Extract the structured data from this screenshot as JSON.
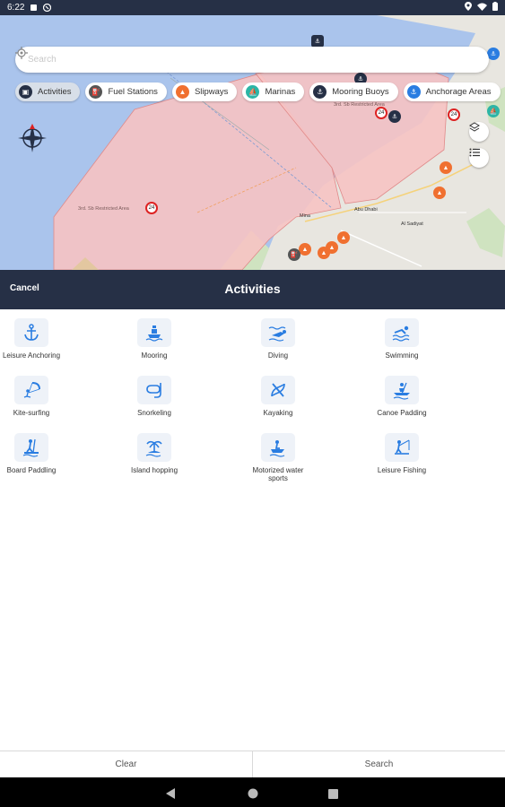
{
  "status_bar": {
    "time": "6:22"
  },
  "search": {
    "placeholder": "Search"
  },
  "chips": [
    {
      "label": "Activities",
      "color": "#263046",
      "icon": "activities-icon",
      "active": true
    },
    {
      "label": "Fuel Stations",
      "color": "#555555",
      "icon": "fuel-icon",
      "active": false
    },
    {
      "label": "Slipways",
      "color": "#f07030",
      "icon": "slipway-icon",
      "active": false
    },
    {
      "label": "Marinas",
      "color": "#2db5a6",
      "icon": "marina-icon",
      "active": false
    },
    {
      "label": "Mooring Buoys",
      "color": "#263046",
      "icon": "buoy-icon",
      "active": false
    },
    {
      "label": "Anchorage Areas",
      "color": "#2a7de1",
      "icon": "anchor-icon",
      "active": false
    }
  ],
  "map_labels": {
    "restricted_1": "3rd. Sb Restricted Area",
    "restricted_2": "3rd. Sb Restricted Area",
    "city": "Abu Dhabi",
    "district": "Al Sadiyat",
    "mina": "Mina"
  },
  "sheet": {
    "cancel_label": "Cancel",
    "title": "Activities"
  },
  "activities": [
    {
      "label": "Leisure Anchoring",
      "icon": "anchor-icon"
    },
    {
      "label": "Mooring",
      "icon": "mooring-icon"
    },
    {
      "label": "Diving",
      "icon": "diving-icon"
    },
    {
      "label": "Swimming",
      "icon": "swimming-icon"
    },
    {
      "label": "Kite-surfing",
      "icon": "kitesurfing-icon"
    },
    {
      "label": "Snorkeling",
      "icon": "snorkeling-icon"
    },
    {
      "label": "Kayaking",
      "icon": "kayaking-icon"
    },
    {
      "label": "Canoe Padding",
      "icon": "canoe-icon"
    },
    {
      "label": "Board Paddling",
      "icon": "board-paddling-icon"
    },
    {
      "label": "Island hopping",
      "icon": "island-hopping-icon"
    },
    {
      "label": "Motorized water sports",
      "icon": "jetski-icon"
    },
    {
      "label": "Leisure Fishing",
      "icon": "fishing-icon"
    }
  ],
  "actions": {
    "clear_label": "Clear",
    "search_label": "Search"
  },
  "colors": {
    "header": "#263046",
    "accent": "#2a7de1",
    "restricted_fill": "#f6c3c3",
    "water": "#aac4ec",
    "land": "#e8e6e0"
  }
}
